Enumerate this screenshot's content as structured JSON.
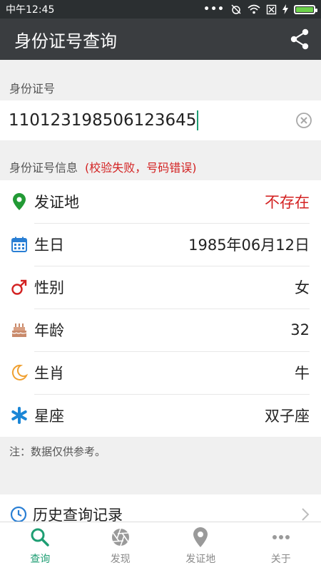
{
  "status_bar": {
    "time": "中午12:45",
    "dots": "•••"
  },
  "app_bar": {
    "title": "身份证号查询",
    "share_icon": "share-icon"
  },
  "id_section": {
    "label": "身份证号"
  },
  "id_input": {
    "value": "110123198506123645",
    "clear_icon": "clear-icon"
  },
  "info_section": {
    "label": "身份证号信息",
    "error": "(校验失败，号码错误)"
  },
  "info_rows": [
    {
      "icon": "location-pin-icon",
      "label": "发证地",
      "value": "不存在"
    },
    {
      "icon": "calendar-icon",
      "label": "生日",
      "value": "1985年06月12日"
    },
    {
      "icon": "male-icon",
      "label": "性别",
      "value": "女"
    },
    {
      "icon": "cake-icon",
      "label": "年龄",
      "value": "32"
    },
    {
      "icon": "moon-icon",
      "label": "生肖",
      "value": "牛"
    },
    {
      "icon": "asterisk-icon",
      "label": "星座",
      "value": "双子座"
    }
  ],
  "note": "注：数据仅供参考。",
  "history": {
    "icon": "clock-icon",
    "label": "历史查询记录"
  },
  "tabs": [
    {
      "label": "查询",
      "icon": "search-icon"
    },
    {
      "label": "发现",
      "icon": "aperture-icon"
    },
    {
      "label": "发证地",
      "icon": "location-pin-icon"
    },
    {
      "label": "关于",
      "icon": "more-dots-icon"
    }
  ],
  "colors": {
    "accent": "#1e9e73",
    "error": "#d32222",
    "appbar": "#3a3d40"
  }
}
